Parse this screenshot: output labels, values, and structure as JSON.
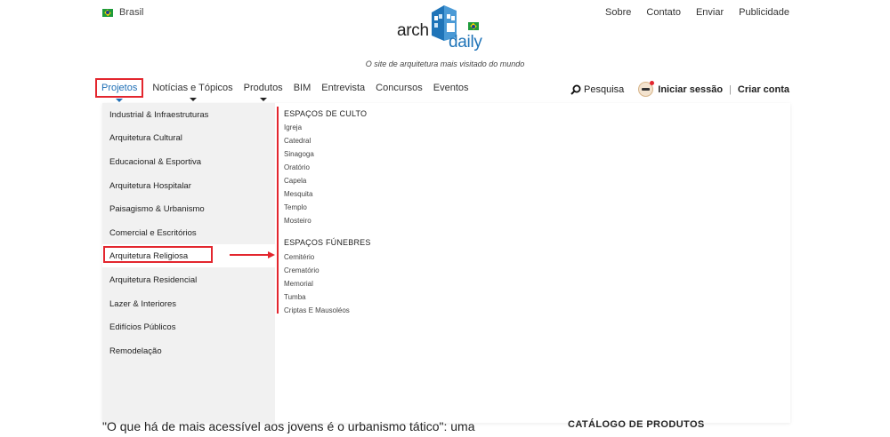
{
  "country": "Brasil",
  "top_links": [
    "Sobre",
    "Contato",
    "Enviar",
    "Publicidade"
  ],
  "logo": {
    "arch": "arch",
    "daily": "daily"
  },
  "tagline": "O site de arquitetura mais visitado do mundo",
  "nav": {
    "items": [
      {
        "label": "Projetos",
        "has_caret": true,
        "active": true
      },
      {
        "label": "Notícias e Tópicos",
        "has_caret": true,
        "active": false
      },
      {
        "label": "Produtos",
        "has_caret": true,
        "active": false
      },
      {
        "label": "BIM",
        "has_caret": false,
        "active": false
      },
      {
        "label": "Entrevista",
        "has_caret": false,
        "active": false
      },
      {
        "label": "Concursos",
        "has_caret": false,
        "active": false
      },
      {
        "label": "Eventos",
        "has_caret": false,
        "active": false
      }
    ],
    "search_label": "Pesquisa",
    "login_label": "Iniciar sessão",
    "signup_label": "Criar conta"
  },
  "dropdown": {
    "categories": [
      "Industrial & Infraestruturas",
      "Arquitetura Cultural",
      "Educacional & Esportiva",
      "Arquitetura Hospitalar",
      "Paisagismo & Urbanismo",
      "Comercial e Escritórios",
      "Arquitetura Religiosa",
      "Arquitetura Residencial",
      "Lazer & Interiores",
      "Edifícios Públicos",
      "Remodelação"
    ],
    "selected_category": "Arquitetura Religiosa",
    "groups": [
      {
        "title": "ESPAÇOS DE CULTO",
        "items": [
          "Igreja",
          "Catedral",
          "Sinagoga",
          "Oratório",
          "Capela",
          "Mesquita",
          "Templo",
          "Mosteiro"
        ]
      },
      {
        "title": "ESPAÇOS FÚNEBRES",
        "items": [
          "Cemitério",
          "Crematório",
          "Memorial",
          "Tumba",
          "Criptas E Mausoléos"
        ]
      }
    ]
  },
  "article_title": "\"O que há de mais acessível aos jovens é o urbanismo tático\": uma",
  "side_title": "CATÁLOGO DE PRODUTOS",
  "colors": {
    "highlight": "#e3262e",
    "link_blue": "#1f6fb5",
    "menu_bg": "#f1f1f1"
  },
  "icons": [
    "brazil-flag-icon",
    "search-icon",
    "avatar-icon",
    "caret-down-icon",
    "arrow-right-icon"
  ]
}
